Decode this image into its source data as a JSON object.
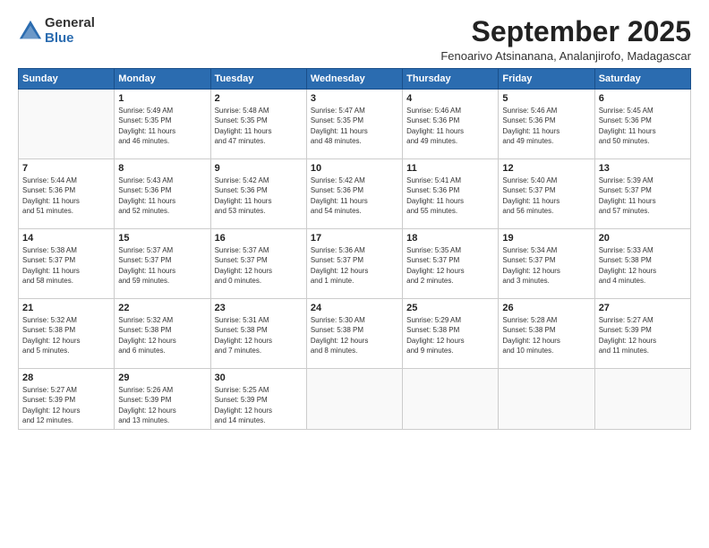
{
  "logo": {
    "general": "General",
    "blue": "Blue"
  },
  "title": "September 2025",
  "subtitle": "Fenoarivo Atsinanana, Analanjirofo, Madagascar",
  "header_days": [
    "Sunday",
    "Monday",
    "Tuesday",
    "Wednesday",
    "Thursday",
    "Friday",
    "Saturday"
  ],
  "weeks": [
    [
      {
        "day": "",
        "info": ""
      },
      {
        "day": "1",
        "info": "Sunrise: 5:49 AM\nSunset: 5:35 PM\nDaylight: 11 hours\nand 46 minutes."
      },
      {
        "day": "2",
        "info": "Sunrise: 5:48 AM\nSunset: 5:35 PM\nDaylight: 11 hours\nand 47 minutes."
      },
      {
        "day": "3",
        "info": "Sunrise: 5:47 AM\nSunset: 5:35 PM\nDaylight: 11 hours\nand 48 minutes."
      },
      {
        "day": "4",
        "info": "Sunrise: 5:46 AM\nSunset: 5:36 PM\nDaylight: 11 hours\nand 49 minutes."
      },
      {
        "day": "5",
        "info": "Sunrise: 5:46 AM\nSunset: 5:36 PM\nDaylight: 11 hours\nand 49 minutes."
      },
      {
        "day": "6",
        "info": "Sunrise: 5:45 AM\nSunset: 5:36 PM\nDaylight: 11 hours\nand 50 minutes."
      }
    ],
    [
      {
        "day": "7",
        "info": "Sunrise: 5:44 AM\nSunset: 5:36 PM\nDaylight: 11 hours\nand 51 minutes."
      },
      {
        "day": "8",
        "info": "Sunrise: 5:43 AM\nSunset: 5:36 PM\nDaylight: 11 hours\nand 52 minutes."
      },
      {
        "day": "9",
        "info": "Sunrise: 5:42 AM\nSunset: 5:36 PM\nDaylight: 11 hours\nand 53 minutes."
      },
      {
        "day": "10",
        "info": "Sunrise: 5:42 AM\nSunset: 5:36 PM\nDaylight: 11 hours\nand 54 minutes."
      },
      {
        "day": "11",
        "info": "Sunrise: 5:41 AM\nSunset: 5:36 PM\nDaylight: 11 hours\nand 55 minutes."
      },
      {
        "day": "12",
        "info": "Sunrise: 5:40 AM\nSunset: 5:37 PM\nDaylight: 11 hours\nand 56 minutes."
      },
      {
        "day": "13",
        "info": "Sunrise: 5:39 AM\nSunset: 5:37 PM\nDaylight: 11 hours\nand 57 minutes."
      }
    ],
    [
      {
        "day": "14",
        "info": "Sunrise: 5:38 AM\nSunset: 5:37 PM\nDaylight: 11 hours\nand 58 minutes."
      },
      {
        "day": "15",
        "info": "Sunrise: 5:37 AM\nSunset: 5:37 PM\nDaylight: 11 hours\nand 59 minutes."
      },
      {
        "day": "16",
        "info": "Sunrise: 5:37 AM\nSunset: 5:37 PM\nDaylight: 12 hours\nand 0 minutes."
      },
      {
        "day": "17",
        "info": "Sunrise: 5:36 AM\nSunset: 5:37 PM\nDaylight: 12 hours\nand 1 minute."
      },
      {
        "day": "18",
        "info": "Sunrise: 5:35 AM\nSunset: 5:37 PM\nDaylight: 12 hours\nand 2 minutes."
      },
      {
        "day": "19",
        "info": "Sunrise: 5:34 AM\nSunset: 5:37 PM\nDaylight: 12 hours\nand 3 minutes."
      },
      {
        "day": "20",
        "info": "Sunrise: 5:33 AM\nSunset: 5:38 PM\nDaylight: 12 hours\nand 4 minutes."
      }
    ],
    [
      {
        "day": "21",
        "info": "Sunrise: 5:32 AM\nSunset: 5:38 PM\nDaylight: 12 hours\nand 5 minutes."
      },
      {
        "day": "22",
        "info": "Sunrise: 5:32 AM\nSunset: 5:38 PM\nDaylight: 12 hours\nand 6 minutes."
      },
      {
        "day": "23",
        "info": "Sunrise: 5:31 AM\nSunset: 5:38 PM\nDaylight: 12 hours\nand 7 minutes."
      },
      {
        "day": "24",
        "info": "Sunrise: 5:30 AM\nSunset: 5:38 PM\nDaylight: 12 hours\nand 8 minutes."
      },
      {
        "day": "25",
        "info": "Sunrise: 5:29 AM\nSunset: 5:38 PM\nDaylight: 12 hours\nand 9 minutes."
      },
      {
        "day": "26",
        "info": "Sunrise: 5:28 AM\nSunset: 5:38 PM\nDaylight: 12 hours\nand 10 minutes."
      },
      {
        "day": "27",
        "info": "Sunrise: 5:27 AM\nSunset: 5:39 PM\nDaylight: 12 hours\nand 11 minutes."
      }
    ],
    [
      {
        "day": "28",
        "info": "Sunrise: 5:27 AM\nSunset: 5:39 PM\nDaylight: 12 hours\nand 12 minutes."
      },
      {
        "day": "29",
        "info": "Sunrise: 5:26 AM\nSunset: 5:39 PM\nDaylight: 12 hours\nand 13 minutes."
      },
      {
        "day": "30",
        "info": "Sunrise: 5:25 AM\nSunset: 5:39 PM\nDaylight: 12 hours\nand 14 minutes."
      },
      {
        "day": "",
        "info": ""
      },
      {
        "day": "",
        "info": ""
      },
      {
        "day": "",
        "info": ""
      },
      {
        "day": "",
        "info": ""
      }
    ]
  ]
}
